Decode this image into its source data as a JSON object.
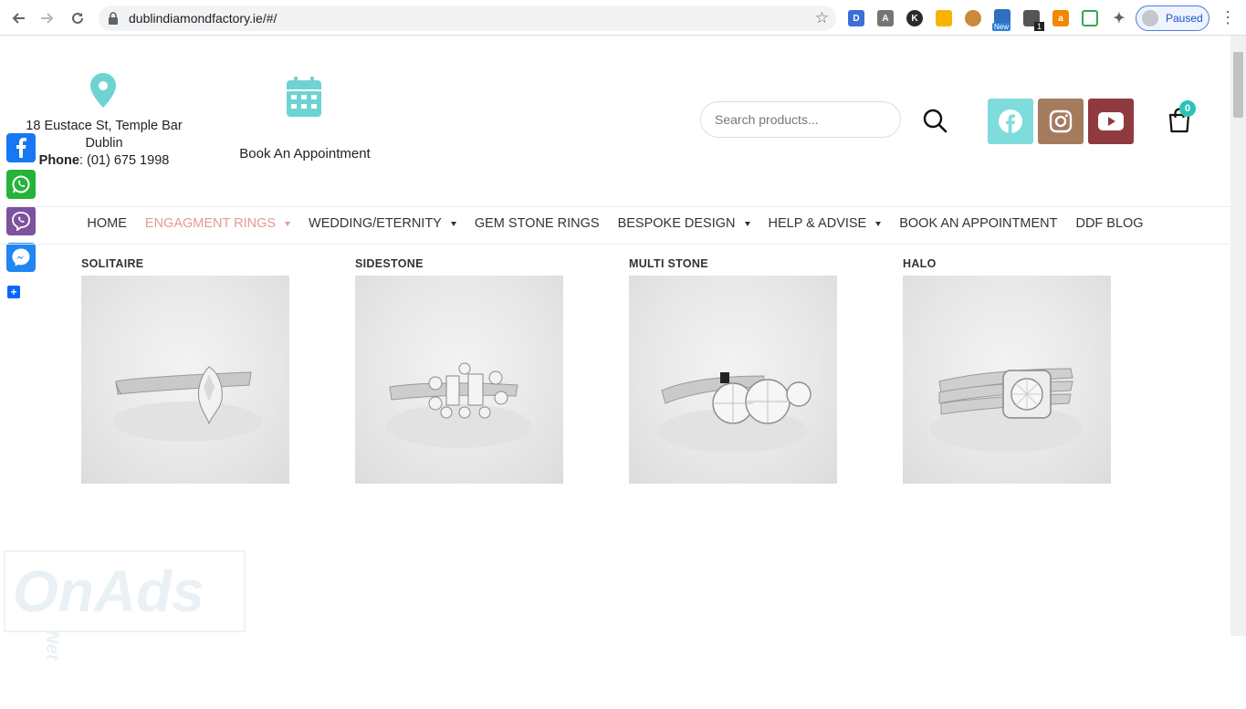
{
  "browser": {
    "url": "dublindiamondfactory.ie/#/",
    "profile_label": "Paused",
    "extension_badge_new": "New",
    "extension_badge_count": "1",
    "extension_letter_d": "D",
    "extension_letter_k": "K"
  },
  "header": {
    "address_line1": "18 Eustace St, Temple Bar",
    "address_line2": "Dublin",
    "phone_label": "Phone",
    "phone_value": ": (01) 675 1998",
    "book_label": "Book An Appointment",
    "search_placeholder": "Search products...",
    "cart_count": "0",
    "social_colors": {
      "facebook": "#7fdcdc",
      "instagram": "#a57b5e",
      "youtube": "#8f3a3f"
    }
  },
  "nav": {
    "items": [
      {
        "label": "HOME",
        "dropdown": false,
        "active": false
      },
      {
        "label": "ENGAGMENT RINGS",
        "dropdown": true,
        "active": true
      },
      {
        "label": "WEDDING/ETERNITY",
        "dropdown": true,
        "active": false
      },
      {
        "label": "GEM STONE RINGS",
        "dropdown": false,
        "active": false
      },
      {
        "label": "BESPOKE DESIGN",
        "dropdown": true,
        "active": false
      },
      {
        "label": "HELP & ADVISE",
        "dropdown": true,
        "active": false
      },
      {
        "label": "BOOK AN APPOINTMENT",
        "dropdown": false,
        "active": false
      },
      {
        "label": "DDF BLOG",
        "dropdown": false,
        "active": false
      }
    ]
  },
  "dropdown": {
    "categories": [
      {
        "title": "SOLITAIRE",
        "image": "pear-solitaire-ring-image"
      },
      {
        "title": "SIDESTONE",
        "image": "baguette-sidestone-ring-image"
      },
      {
        "title": "MULTI STONE",
        "image": "three-stone-ring-image"
      },
      {
        "title": "HALO",
        "image": "halo-split-shank-ring-image"
      }
    ]
  },
  "watermark": {
    "text": "OnAds",
    "suffix": "Net"
  },
  "colors": {
    "accent": "#6fd3d3",
    "menu_active": "#e39a92"
  }
}
